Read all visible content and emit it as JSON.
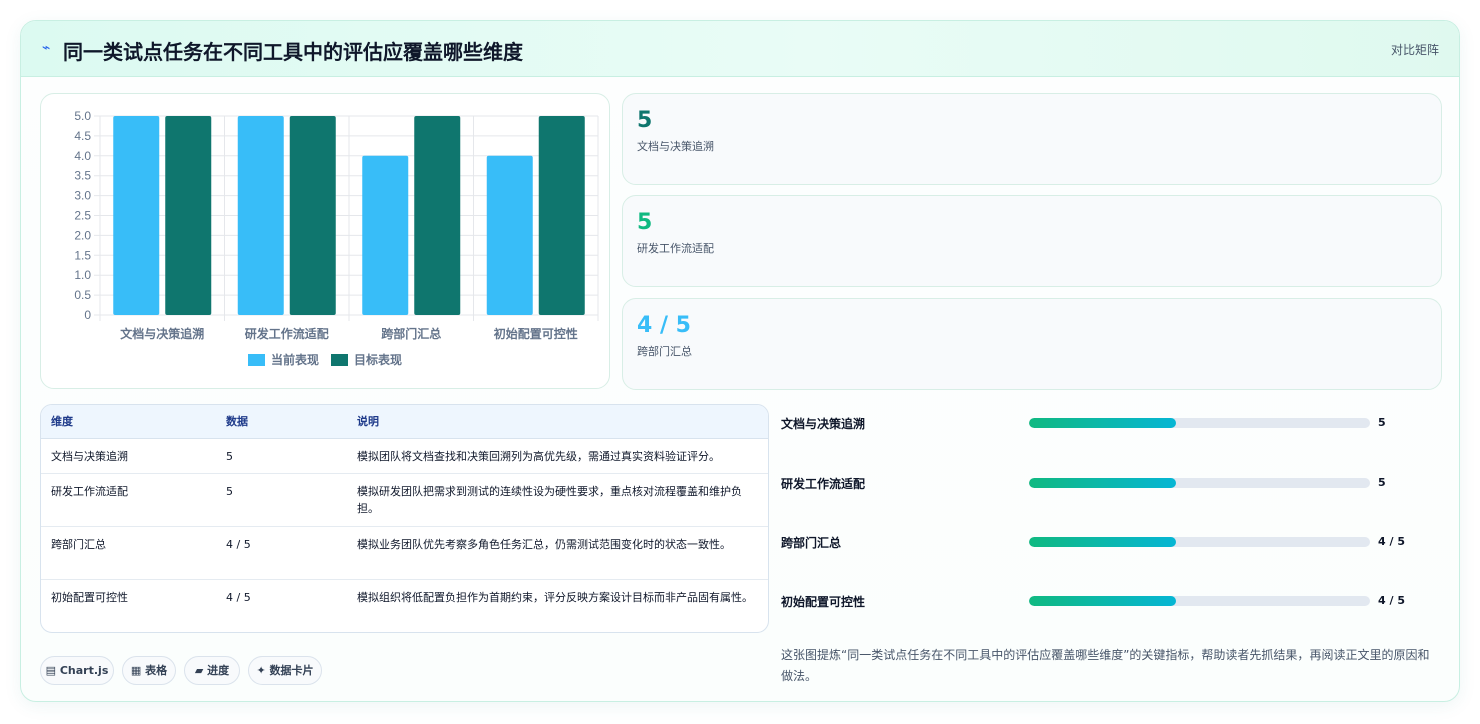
{
  "header": {
    "icon": "trend-icon",
    "title": "同一类试点任务在不同工具中的评估应覆盖哪些维度",
    "link": "对比矩阵"
  },
  "chart_data": {
    "type": "bar",
    "categories": [
      "文档与决策追溯",
      "研发工作流适配",
      "跨部门汇总",
      "初始配置可控性"
    ],
    "series": [
      {
        "name": "当前表现",
        "values": [
          5,
          5,
          4,
          4
        ],
        "color": "#38bdf8"
      },
      {
        "name": "目标表现",
        "values": [
          5,
          5,
          5,
          5
        ],
        "color": "#0f766e"
      }
    ],
    "ylim": [
      0,
      5
    ],
    "yticks": [
      "5.0",
      "4.5",
      "4.0",
      "3.5",
      "3.0",
      "2.5",
      "2.0",
      "1.5",
      "1.0",
      "0.5",
      "0"
    ],
    "legend_position": "bottom",
    "grid": true
  },
  "kpis": [
    {
      "value": "5",
      "label": "文档与决策追溯",
      "color": "#0f766e"
    },
    {
      "value": "5",
      "label": "研发工作流适配",
      "color": "#10b981"
    },
    {
      "value": "4 / 5",
      "label": "跨部门汇总",
      "color": "#38bdf8"
    }
  ],
  "table": {
    "headers": [
      "维度",
      "数据",
      "说明"
    ],
    "rows": [
      {
        "dim": "文档与决策追溯",
        "data": "5",
        "desc": "模拟团队将文档查找和决策回溯列为高优先级，需通过真实资料验证评分。"
      },
      {
        "dim": "研发工作流适配",
        "data": "5",
        "desc": "模拟研发团队把需求到测试的连续性设为硬性要求，重点核对流程覆盖和维护负担。"
      },
      {
        "dim": "跨部门汇总",
        "data": "4 / 5",
        "desc": "模拟业务团队优先考察多角色任务汇总，仍需测试范围变化时的状态一致性。"
      },
      {
        "dim": "初始配置可控性",
        "data": "4 / 5",
        "desc": "模拟组织将低配置负担作为首期约束，评分反映方案设计目标而非产品固有属性。"
      }
    ]
  },
  "progress": [
    {
      "label": "文档与决策追溯",
      "fraction": 0.43,
      "value": "5"
    },
    {
      "label": "研发工作流适配",
      "fraction": 0.43,
      "value": "5"
    },
    {
      "label": "跨部门汇总",
      "fraction": 0.43,
      "value": "4 / 5"
    },
    {
      "label": "初始配置可控性",
      "fraction": 0.43,
      "value": "4 / 5"
    }
  ],
  "tags": [
    {
      "icon": "chart-icon",
      "glyph": "▤",
      "label": "Chart.js"
    },
    {
      "icon": "table-icon",
      "glyph": "▦",
      "label": "表格"
    },
    {
      "icon": "progress-icon",
      "glyph": "▰",
      "label": "进度"
    },
    {
      "icon": "sparkle-icon",
      "glyph": "✦",
      "label": "数据卡片"
    }
  ],
  "summary": "这张图提炼“同一类试点任务在不同工具中的评估应覆盖哪些维度”的关键指标，帮助读者先抓结果，再阅读正文里的原因和做法。"
}
